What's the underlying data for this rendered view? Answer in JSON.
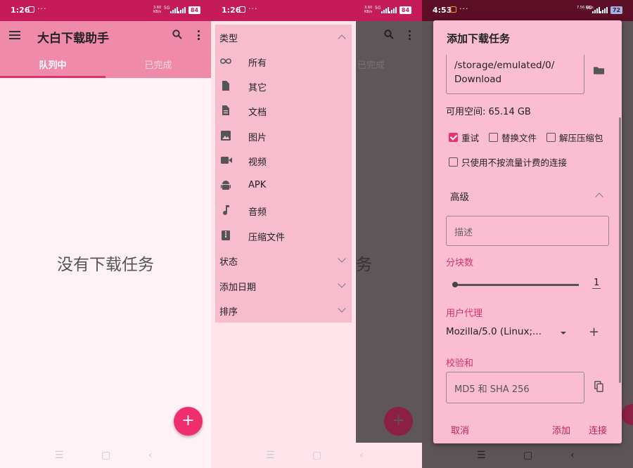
{
  "status": {
    "s1_time": "1:26",
    "s2_time": "1:26",
    "s3_time": "4:53",
    "dots": "···",
    "s1_speed": "3.60\nKB/s",
    "s3_speed": "7.56\nKB/s",
    "lte": "5G",
    "s1_battery": "84",
    "s2_battery": "84",
    "s3_battery": "72"
  },
  "app": {
    "title": "大白下载助手",
    "tabs": [
      "队列中",
      "已完成"
    ],
    "empty_message": "没有下载任务",
    "fab_label": "+"
  },
  "drawer": {
    "type_section": "类型",
    "items": [
      {
        "label": "所有",
        "icon": "infinity-icon"
      },
      {
        "label": "其它",
        "icon": "file-icon"
      },
      {
        "label": "文档",
        "icon": "document-icon"
      },
      {
        "label": "图片",
        "icon": "image-icon"
      },
      {
        "label": "视频",
        "icon": "video-icon"
      },
      {
        "label": "APK",
        "icon": "android-icon"
      },
      {
        "label": "音频",
        "icon": "music-icon"
      },
      {
        "label": "压缩文件",
        "icon": "archive-icon"
      }
    ],
    "status_section": "状态",
    "date_section": "添加日期",
    "sort_section": "排序"
  },
  "dialog": {
    "title": "添加下载任务",
    "path": "/storage/emulated/0/\nDownload",
    "free_space": "可用空间: 65.14 GB",
    "checkboxes": [
      {
        "label": "重试",
        "checked": true
      },
      {
        "label": "替换文件",
        "checked": false
      },
      {
        "label": "解压压缩包",
        "checked": false
      },
      {
        "label": "只使用不按流量计费的连接",
        "checked": false
      }
    ],
    "advanced_label": "高级",
    "description_placeholder": "描述",
    "chunks_label": "分块数",
    "chunks_value": "1",
    "user_agent_label": "用户代理",
    "user_agent_value": "Mozilla/5.0 (Linux;...",
    "checksum_label": "校验和",
    "checksum_placeholder": "MD5 和 SHA 256",
    "cancel": "取消",
    "add": "添加",
    "connect": "连接"
  },
  "colors": {
    "status_bar": "#c51b58",
    "app_bar": "#f08aaa",
    "accent": "#f02e6e",
    "drawer_panel": "#f8bccf",
    "dialog_bg": "#fbbdd1"
  }
}
